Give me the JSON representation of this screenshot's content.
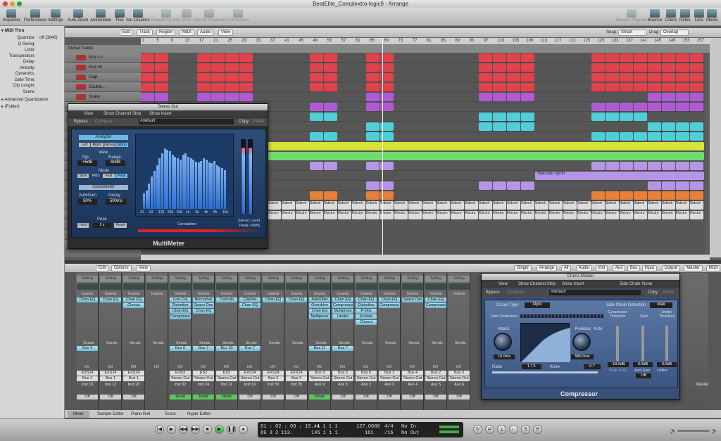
{
  "window": {
    "title": "BeatElite_Complextro-logic9 - Arrange"
  },
  "toolbar": {
    "left": [
      "Inspector",
      "Preferences",
      "Settings",
      "Auto Zoom",
      "Automation",
      "Flex",
      "Set Locators",
      "Repeat Section",
      "Crop",
      "Split by Playhead",
      "Cut Section"
    ],
    "right": [
      "Bounce Regions",
      "Bounce",
      "Colors",
      "Notes",
      "Lists",
      "Media"
    ]
  },
  "inspector": {
    "title": "MIDI Thru",
    "rows": [
      {
        "k": "Quantize:",
        "v": "off (3840)"
      },
      {
        "k": "Q-Swing:",
        "v": ""
      },
      {
        "k": "Loop:",
        "v": ""
      },
      {
        "k": "Transposition:",
        "v": ""
      },
      {
        "k": "Delay:",
        "v": ""
      },
      {
        "k": "Velocity:",
        "v": ""
      },
      {
        "k": "Dynamics:",
        "v": ""
      },
      {
        "k": "Gate Time:",
        "v": ""
      },
      {
        "k": "Clip Length:",
        "v": ""
      },
      {
        "k": "Score:",
        "v": ""
      }
    ],
    "adv": "Advanced Quantization",
    "folder": "(Folder)"
  },
  "arrange": {
    "menus": [
      "Edit",
      "Track",
      "Region",
      "MIDI",
      "Audio",
      "View"
    ],
    "snap_label": "Snap:",
    "snap_value": "Smart",
    "drag_label": "Drag:",
    "drag_value": "Overlap",
    "global_tracks": "Global Tracks",
    "ruler": [
      "1",
      "5",
      "9",
      "13",
      "17",
      "21",
      "25",
      "29",
      "33",
      "37",
      "41",
      "45",
      "49",
      "53",
      "57",
      "61",
      "65",
      "69",
      "73",
      "77",
      "81",
      "85",
      "89",
      "93",
      "97",
      "101",
      "105",
      "109",
      "113",
      "117",
      "121",
      "125",
      "129",
      "133",
      "137",
      "141",
      "145",
      "149",
      "153",
      "157"
    ],
    "tracks": [
      "Kick Lo",
      "Kick Hi",
      "Clap",
      "Double...",
      "Snare"
    ],
    "region_label": "Staccato synth",
    "sidechain": "Sidech",
    "electro": "Electro"
  },
  "multimeter": {
    "title": "Stereo Out",
    "view": "View",
    "strip": "Show Channel Strip",
    "insert": "Show Insert",
    "bypass": "Bypass",
    "compare": "Compare",
    "preset": "#default",
    "copy": "Copy",
    "paste": "Paste",
    "analyzer": "Analyzer",
    "modes": [
      "Left",
      "Right",
      "LRmax",
      "Mono"
    ],
    "view_label": "View",
    "top": "Top",
    "range": "Range",
    "top_v": "+5dB",
    "range_v": "60dB",
    "mode": "Mode",
    "mode_opts": [
      "Slow",
      "RMS",
      "Fast",
      "Peak"
    ],
    "gonio": "Goniometer",
    "autogain": "AutoGain",
    "decay": "Decay",
    "autogain_v": "50%",
    "decay_v": "500ms",
    "peak": "Peak",
    "hold": "Hold",
    "hold_v": "2 s",
    "reset": "Reset",
    "freq": [
      "31",
      "62",
      "125",
      "250",
      "500",
      "1k",
      "2k",
      "4k",
      "8k",
      "16k"
    ],
    "correlation": "Correlation",
    "level": "Stereo Level",
    "peakrms": "Peak / RMS",
    "name": "MultiMeter",
    "spectrum": [
      18,
      22,
      30,
      38,
      45,
      52,
      60,
      66,
      72,
      70,
      68,
      64,
      62,
      60,
      58,
      64,
      66,
      62,
      60,
      58,
      56,
      55,
      57,
      60,
      58,
      55,
      54,
      57,
      52,
      50,
      48,
      46
    ],
    "lr": [
      0.9,
      0.9
    ]
  },
  "mixer": {
    "menus": [
      "Edit",
      "Options",
      "View"
    ],
    "views": [
      "Single",
      "Arrange",
      "All",
      "Audio",
      "Inst",
      "Aux",
      "Bus",
      "Input",
      "Output",
      "Master",
      "MIDI"
    ],
    "strips": [
      {
        "plugs": [
          "Chan EQ"
        ],
        "send": "Bus 4",
        "io1": "EXS24",
        "io2": "Bus 1",
        "name": "Inst 10",
        "auto": "Off"
      },
      {
        "plugs": [
          "Chan EQ"
        ],
        "send": "",
        "io1": "EXS24",
        "io2": "Bus 1",
        "name": "Inst 12",
        "auto": "Off"
      },
      {
        "plugs": [
          "Chan EQ",
          "Chorus"
        ],
        "send": "",
        "io1": "EXS24",
        "io2": "Bus 1",
        "name": "Inst 28",
        "auto": "Off"
      },
      {
        "plugs": [],
        "send": "",
        "io1": "",
        "io2": "",
        "name": "",
        "auto": ""
      },
      {
        "plugs": [
          "Low Cut",
          "Distortion",
          "Chan EQ",
          "Compresso"
        ],
        "send": "Bus 6",
        "io1": "EVB3",
        "io2": "Stereo Out",
        "name": "Inst 32",
        "auto": "Read"
      },
      {
        "plugs": [
          "Bitcrusher",
          "Space Des",
          "Chan EQ"
        ],
        "send": "Bus 7",
        "io1": "ES2",
        "io2": "Stereo Out",
        "name": "Inst 24",
        "auto": "Read"
      },
      {
        "plugs": [
          "Tremolo"
        ],
        "send": "Bus 10",
        "io1": "ES2",
        "io2": "Stereo Out",
        "name": "Inst 11",
        "auto": "Read"
      },
      {
        "plugs": [
          "ClipDist",
          "Chan EQ"
        ],
        "send": "Bus 7",
        "io1": "EXS24",
        "io2": "Stereo Out",
        "name": "Inst 13",
        "auto": "Off"
      },
      {
        "plugs": [
          "Chan EQ"
        ],
        "send": "",
        "io1": "EXS24",
        "io2": "Bus 3",
        "name": "Inst 33",
        "auto": "Off"
      },
      {
        "plugs": [
          "Chan EQ"
        ],
        "send": "",
        "io1": "EXS24",
        "io2": "Bus 3",
        "name": "Inst 35",
        "auto": "Off"
      },
      {
        "plugs": [
          "AutoFilter",
          "Overdrive",
          "Chan EQ",
          "Multipress"
        ],
        "send": "Bus 11",
        "io1": "Bus 9",
        "io2": "Stereo Out",
        "name": "Aux 9",
        "auto": "Read"
      },
      {
        "plugs": [
          "Chan EQ",
          "Compresso",
          "Multipress",
          "Limiter"
        ],
        "send": "Bus 7",
        "io1": "Bus 5",
        "io2": "Stereo Out",
        "name": "Aux 5",
        "auto": "Off"
      },
      {
        "plugs": [
          "Chan EQ",
          "Distortion",
          "P-Dist",
          "EnVerb",
          "Chorus"
        ],
        "send": "",
        "io1": "Bus 6",
        "io2": "Stereo Out",
        "name": "Aux 2",
        "auto": "Off"
      },
      {
        "plugs": [
          "Chan EQ",
          "Compresso"
        ],
        "send": "",
        "io1": "Bus 1",
        "io2": "Stereo Out",
        "name": "Aux 3",
        "auto": "Off"
      },
      {
        "plugs": [
          "Space Dsn"
        ],
        "send": "",
        "io1": "Bus 4",
        "io2": "Stereo Out",
        "name": "Aux 4",
        "auto": "Off"
      },
      {
        "plugs": [
          "Chan EQ",
          "Compresso"
        ],
        "send": "",
        "io1": "Bus 2",
        "io2": "Stereo Out",
        "name": "Aux 5",
        "auto": "Off"
      },
      {
        "plugs": [],
        "send": "",
        "io1": "Bus 3",
        "io2": "Stereo Out",
        "name": "Aux 6",
        "auto": "Off"
      }
    ],
    "labels": {
      "setting": "Setting",
      "eq": "EQ",
      "inserts": "Inserts",
      "sends": "Sends",
      "io": "I/O"
    },
    "master": "Master"
  },
  "compressor": {
    "title": "Drums Master",
    "view": "View",
    "strip": "Show Channel Strip",
    "insert": "Show Insert",
    "sidechain": "Side Chain:",
    "sidechain_v": "None",
    "bypass": "Bypass",
    "compare": "Compare",
    "preset": "#default",
    "copy": "Copy",
    "paste": "Paste",
    "circuit": "Circuit Type",
    "circuit_v": "Opto",
    "sc_detect": "Side Chain Detection",
    "sc_detect_v": "Max",
    "gr": "Gain Reduction",
    "attack": "Attack",
    "attack_v": "10.0ms",
    "release": "Release",
    "release_v": "580.0ms",
    "auto": "Auto",
    "ratio": "Ratio",
    "ratio_v": "1.7:1",
    "knee": "Knee",
    "knee_v": "0.7",
    "threshold": "Compressor Threshold",
    "threshold_v": "-18.5dB",
    "gain": "Gain",
    "gain_v": "0.0dB",
    "limiter": "Limiter Threshold",
    "limiter_v": "0.0dB",
    "autogain": "Auto Gain",
    "autogain_v": "Off",
    "peak": "Peak",
    "rms": "RMS",
    "limiter_btn": "Limiter",
    "name": "Compressor"
  },
  "tabs": [
    "Mixer",
    "Sample Editor",
    "Piano Roll",
    "Score",
    "Hyper Editor"
  ],
  "lcd": {
    "time": "01 : 02 : 09 : 15.44",
    "bars": "1  1  1  1",
    "bpm": "127.0000",
    "sig": "4/4",
    "in": "No In",
    "time2": "69   3   2  113.",
    "bars2": "145   1   1   1",
    "val2": "161",
    "div": "/16",
    "out": "No Out"
  }
}
